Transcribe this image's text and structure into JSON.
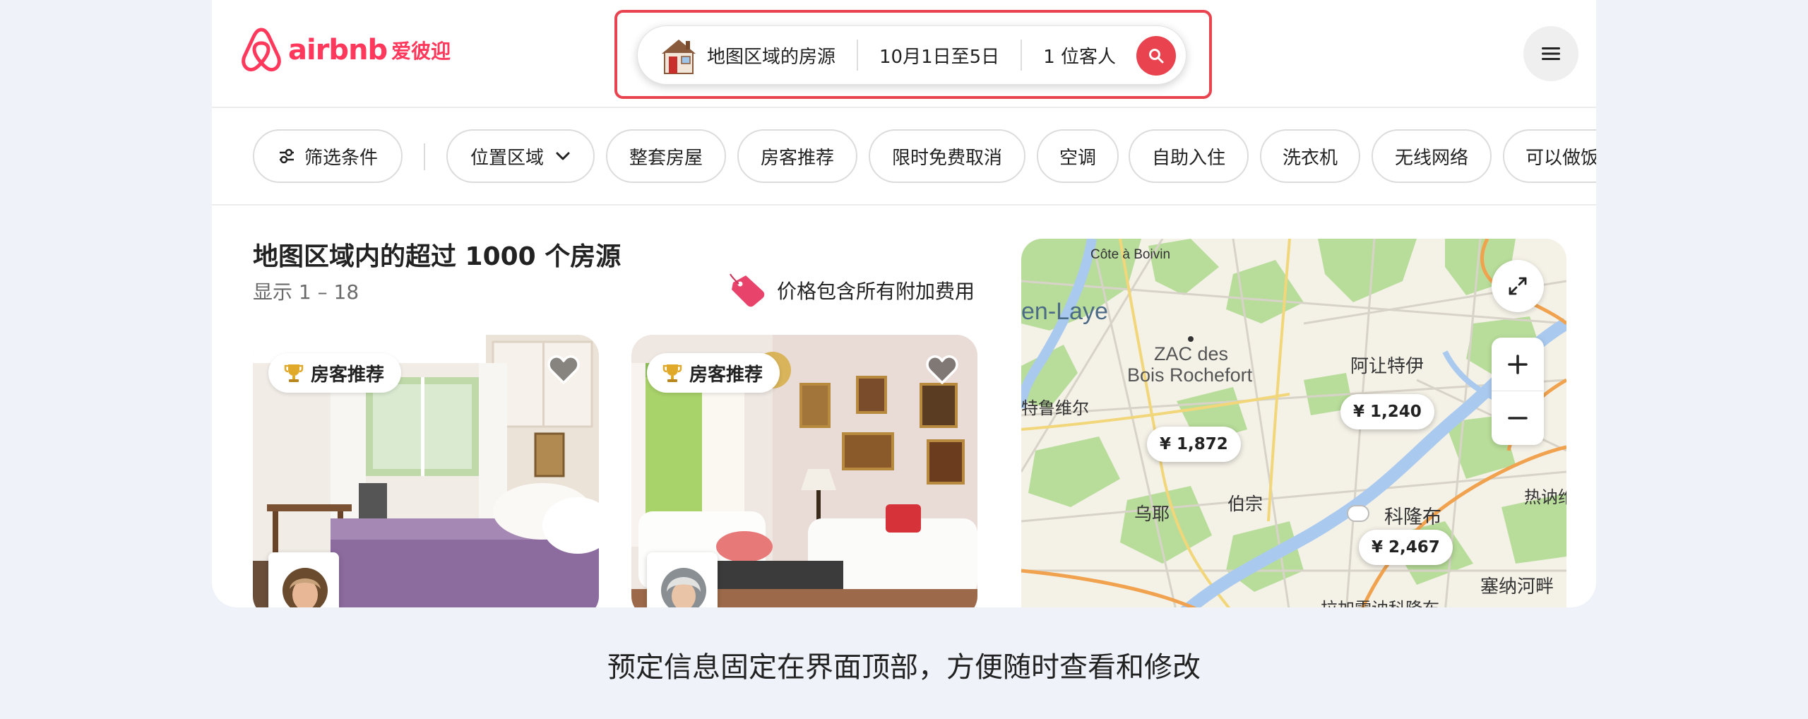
{
  "brand": {
    "wordmark": "airbnb",
    "cn_name": "爱彼迎",
    "accent": "#ff385c"
  },
  "search": {
    "place": "地图区域的房源",
    "dates": "10月1日至5日",
    "guests": "1 位客人",
    "icons": {
      "place": "house-icon",
      "submit": "search-icon"
    }
  },
  "menu": {
    "icon": "hamburger-menu-icon"
  },
  "filters": {
    "filter_button": "筛选条件",
    "chips": [
      "位置区域",
      "整套房屋",
      "房客推荐",
      "限时免费取消",
      "空调",
      "自助入住",
      "洗衣机",
      "无线网络",
      "可以做饭"
    ]
  },
  "results": {
    "title": "地图区域内的超过 1000 个房源",
    "range": "显示 1 – 18",
    "price_note": "价格包含所有附加费用",
    "cards": [
      {
        "badge": "房客推荐"
      },
      {
        "badge": "房客推荐"
      }
    ]
  },
  "map": {
    "labels": [
      "Côte à Boivin",
      "en-Laye",
      "ZAC des",
      "Bois Rochefort",
      "阿让特伊",
      "特鲁维尔",
      "乌耶",
      "伯宗",
      "科隆布",
      "热讷维",
      "塞纳河畔",
      "拉加雷讷科隆布"
    ],
    "price_pins": [
      "¥ 1,240",
      "¥ 1,872",
      "¥ 2,467"
    ],
    "controls": {
      "expand": "expand-icon",
      "zoom_in": "plus-icon",
      "zoom_out": "minus-icon"
    }
  },
  "caption": "预定信息固定在界面顶部，方便随时查看和修改"
}
